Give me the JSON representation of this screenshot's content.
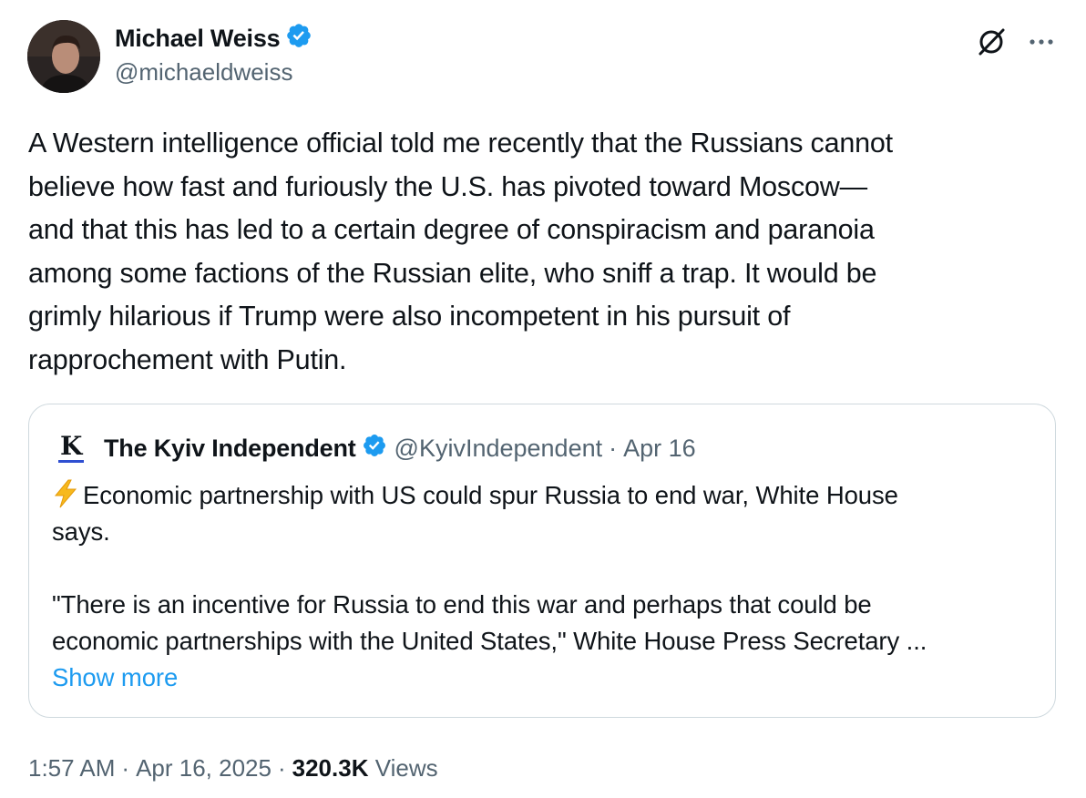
{
  "author": {
    "name": "Michael Weiss",
    "handle": "@michaeldweiss"
  },
  "tweet": {
    "lines": [
      "A Western intelligence official told me recently that the Russians cannot",
      "believe how fast and furiously the U.S. has pivoted toward Moscow—",
      "and that this has led to a certain degree of conspiracism and paranoia",
      "among some factions of the Russian elite, who sniff a trap. It would be",
      "grimly hilarious if Trump were also incompetent in his pursuit of",
      "rapprochement with Putin."
    ]
  },
  "quote": {
    "name": "The Kyiv Independent",
    "handle": "@KyivIndependent",
    "separator": "·",
    "date": "Apr 16",
    "logo_letter": "K",
    "lines": [
      "Economic partnership with US could spur Russia to end war, White House",
      "says.",
      "\"There is an incentive for Russia to end this war and perhaps that could be",
      "economic partnerships with the United States,\" White House Press Secretary ..."
    ],
    "show_more": "Show more"
  },
  "meta": {
    "time": "1:57 AM",
    "sep": "·",
    "date": "Apr 16, 2025",
    "views_count": "320.3K",
    "views_label": "Views"
  },
  "icons": {
    "verified": "verified-badge-icon",
    "grok": "grok-icon",
    "more": "more-options-icon",
    "bolt": "lightning-bolt-emoji"
  },
  "colors": {
    "accent": "#1d9bf0",
    "text": "#0f1419",
    "secondary": "#536471",
    "border": "#cfd9de"
  }
}
